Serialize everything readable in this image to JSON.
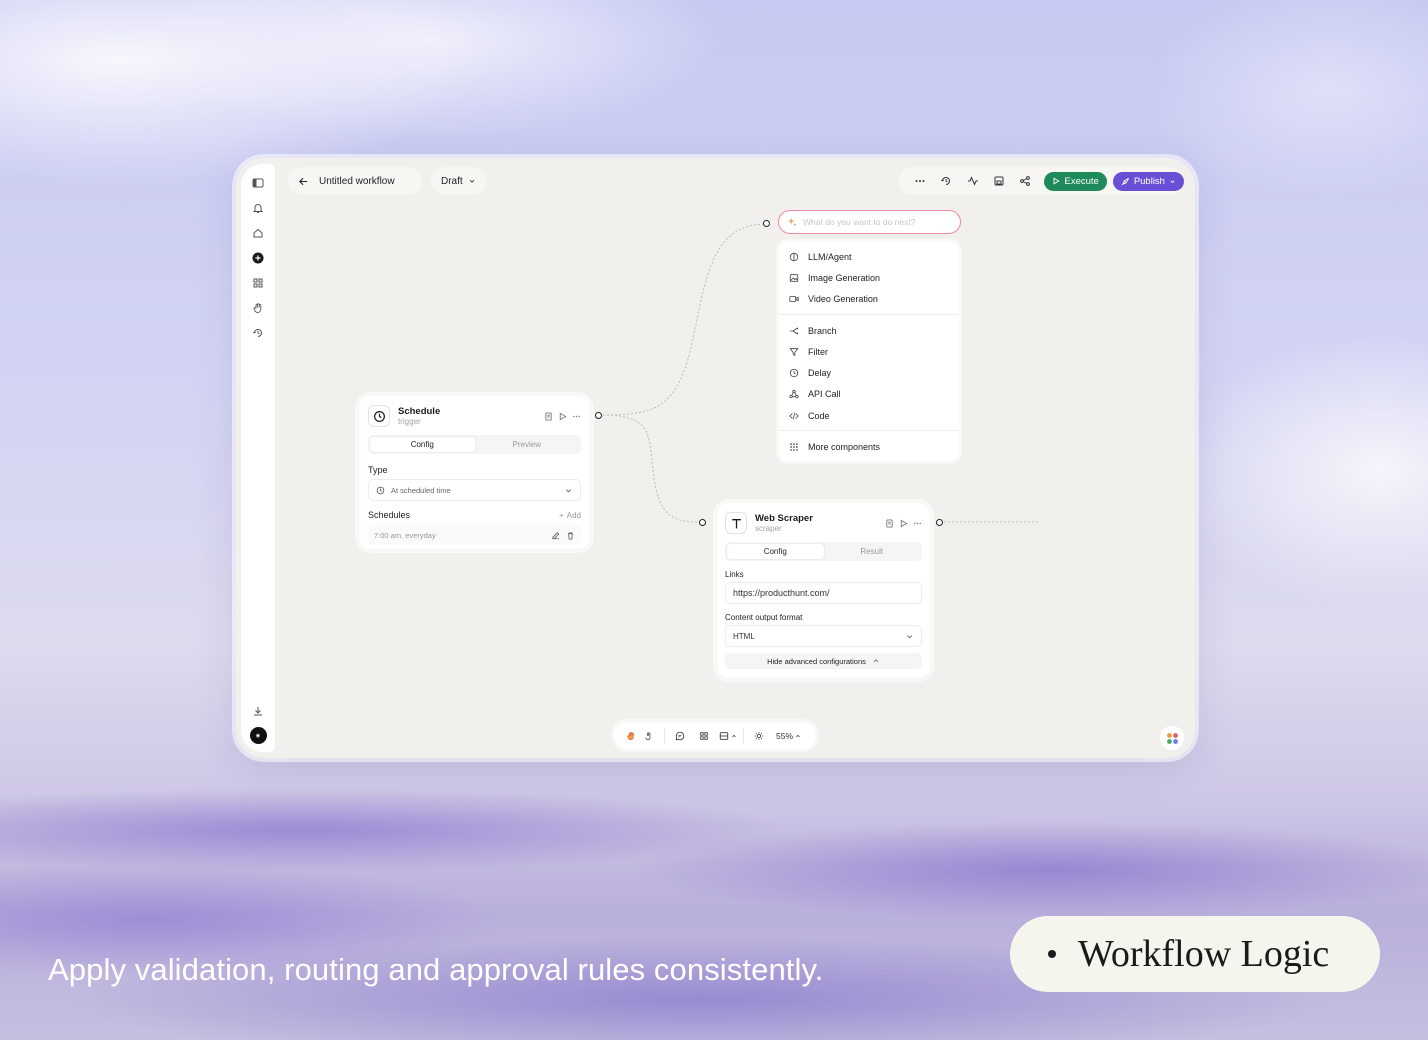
{
  "header": {
    "back_label": "Untitled workflow",
    "status_label": "Draft",
    "execute_label": "Execute",
    "publish_label": "Publish"
  },
  "ai_prompt": {
    "placeholder": "What do you want to do next?"
  },
  "components_menu": {
    "group1": [
      "LLM/Agent",
      "Image Generation",
      "Video Generation"
    ],
    "group2": [
      "Branch",
      "Filter",
      "Delay",
      "API Call",
      "Code"
    ],
    "more": "More components"
  },
  "schedule_node": {
    "title": "Schedule",
    "subtitle": "trigger",
    "tabs": [
      "Config",
      "Preview"
    ],
    "type_label": "Type",
    "type_value": "At scheduled time",
    "schedules_label": "Schedules",
    "add_label": "Add",
    "schedule_item": "7:00 am, everyday"
  },
  "scraper_node": {
    "title": "Web Scraper",
    "subtitle": "scraper",
    "tabs": [
      "Config",
      "Result"
    ],
    "links_label": "Links",
    "links_value": "https://producthunt.com/",
    "format_label": "Content output format",
    "format_value": "HTML",
    "advanced_label": "Hide advanced configurations"
  },
  "bottom_toolbar": {
    "zoom": "55%"
  },
  "caption": {
    "tagline": "Apply validation, routing and approval rules consistently.",
    "badge": "Workflow Logic"
  },
  "colors": {
    "execute": "#1e8a5a",
    "publish": "#6a4fd6",
    "canvas": "#f1f0ec",
    "ai_border": "#ee8ba4"
  }
}
